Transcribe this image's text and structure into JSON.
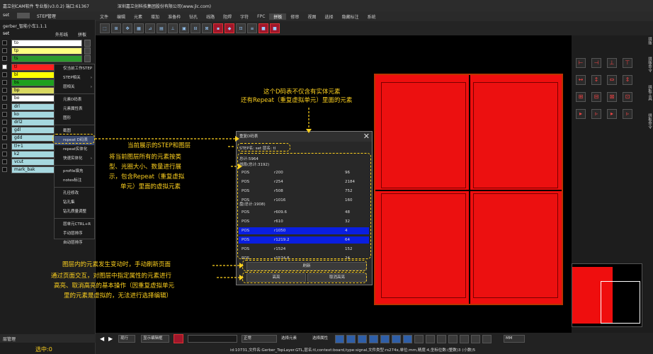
{
  "window": {
    "title": "嘉立创CAM软件 专业版(v3.0.2) 端口:61367",
    "company": "深圳嘉立创科技集团股份有限公司(www.jlc.com)"
  },
  "left_panel": {
    "top_tab": "set",
    "step_manager_label": "STEP管理",
    "job_name": "gerber_智能小车1.1.1",
    "step_name": "set",
    "outer_label": "外形线",
    "panel_label": "拼板",
    "layers": [
      {
        "name": "to",
        "color": "#ffffff"
      },
      {
        "name": "tp",
        "color": "#ffff80"
      },
      {
        "name": "ts",
        "color": "#2e9b2e"
      },
      {
        "name": "tl",
        "color": "#ff2020"
      },
      {
        "name": "bl",
        "color": "#ffff00"
      },
      {
        "name": "bs",
        "color": "#1ea01e"
      },
      {
        "name": "bp",
        "color": "#d8d860"
      },
      {
        "name": "bo",
        "color": "#ffffff"
      },
      {
        "name": "drl",
        "color": "#a6d8df"
      },
      {
        "name": "ko",
        "color": "#a6d8df"
      },
      {
        "name": "drl2",
        "color": "#a6d8df"
      },
      {
        "name": "gdl",
        "color": "#a6d8df"
      },
      {
        "name": "gdd",
        "color": "#a6d8df"
      },
      {
        "name": "tl+1",
        "color": "#a6d8df"
      },
      {
        "name": "k2",
        "color": "#a6d8df"
      },
      {
        "name": "vcut",
        "color": "#a6d8df"
      },
      {
        "name": "mark_bak",
        "color": "#a6d8df"
      }
    ],
    "bottom_label": "层管理",
    "selected_count": "选中:0"
  },
  "context_menu": {
    "items": [
      {
        "label": "仅当前工作STEP",
        "arrow": ""
      },
      {
        "label": "STEP相关",
        "arrow": "›"
      },
      {
        "label": "层相关",
        "arrow": "›"
      },
      {
        "sep": true
      },
      {
        "label": "元素D码表",
        "arrow": ""
      },
      {
        "label": "元素属性表",
        "arrow": ""
      },
      {
        "label": "图形",
        "arrow": ""
      },
      {
        "sep": true
      },
      {
        "label": "截图",
        "arrow": ""
      },
      {
        "label": "repeat D码表",
        "arrow": "",
        "selected": true
      },
      {
        "label": "repeat实体化",
        "arrow": ""
      },
      {
        "label": "快速实体化",
        "arrow": "›"
      },
      {
        "sep": true
      },
      {
        "label": "profile填充",
        "arrow": ""
      },
      {
        "label": "notes标注",
        "arrow": ""
      },
      {
        "sep": true
      },
      {
        "label": "孔径修改",
        "arrow": ""
      },
      {
        "label": "钻孔集",
        "arrow": ""
      },
      {
        "label": "钻孔质量调整",
        "arrow": ""
      },
      {
        "sep": true
      },
      {
        "label": "层单元CTRL+R",
        "arrow": ""
      },
      {
        "label": "手动层排序",
        "arrow": ""
      },
      {
        "label": "自动层排序",
        "arrow": ""
      }
    ]
  },
  "menubar": [
    "文件",
    "编辑",
    "元素",
    "增加",
    "准备枠",
    "钻孔",
    "线路",
    "阻焊",
    "字符",
    "FPC",
    "拼板",
    "修审",
    "视图",
    "选择",
    "隐藏标注",
    "系统"
  ],
  "menubar_active": "拼板",
  "dialog": {
    "title": "重复D码表",
    "step_line": "STEP名: set  层名: tl",
    "total": "总计:5964",
    "group1": "线段(总计:3192)",
    "rows1": [
      {
        "type": "POS",
        "code": "r200",
        "count": "96"
      },
      {
        "type": "POS",
        "code": "r254",
        "count": "2184"
      },
      {
        "type": "POS",
        "code": "r508",
        "count": "752"
      },
      {
        "type": "POS",
        "code": "r1016",
        "count": "160"
      }
    ],
    "group2": "盘(总计:1908)",
    "rows2": [
      {
        "type": "POS",
        "code": "r609.6",
        "count": "48",
        "hi": false
      },
      {
        "type": "POS",
        "code": "r610",
        "count": "32",
        "hi": false
      },
      {
        "type": "POS",
        "code": "r1050",
        "count": "4",
        "hi": true
      },
      {
        "type": "POS",
        "code": "r1219.2",
        "count": "64",
        "hi": true
      },
      {
        "type": "POS",
        "code": "r1524",
        "count": "152",
        "hi": false
      },
      {
        "type": "POS",
        "code": "r1574.8",
        "count": "24",
        "hi": false
      }
    ],
    "refresh": "刷新",
    "highlight": "高亮",
    "clear_highlight": "取消高亮"
  },
  "annotations": {
    "a1": "这个D码表不仅含有实体元素",
    "a2": "还有Repeat（重复虚拟单元）里面的元素",
    "a3": "当前展示的STEP和图层",
    "a4": "将当前图层所有的元素按类",
    "a5": "型、光圈大小、数量进行展",
    "a6": "示，包含Repeat（重复虚拟",
    "a7": "单元）里面的虚拟元素",
    "a8": "图层内的元素发生变动时，手动刷新页面",
    "a9": "通过页面交互，对图层中指定属性的元素进行",
    "a10": "高亮、取消高亮的基本操作（因重复虚拟单元",
    "a11": "里的元素是虚拟的，无法进行选择编辑）"
  },
  "right_panel": {
    "labels": [
      "拼版",
      "拼版命令",
      "拼板工具",
      "拼板命令"
    ]
  },
  "bottom_toolbar": {
    "mode": "现行",
    "fill_mode": "正常",
    "units": "MM",
    "align": "显示编辑框",
    "select": "选择元素",
    "filter": "选择属性"
  },
  "status": {
    "text": "id:10731,文件名:Gerber_TopLayer.GTL,层名:tl,context:board,type:signal,文件类型:rs274x,单位:mm,精度:4,坐标位数:(整数)3 (小数)5"
  },
  "colors": {
    "accent": "#ffd21f",
    "board": "#ef0e0e",
    "highlight": "#0a1ee0"
  }
}
